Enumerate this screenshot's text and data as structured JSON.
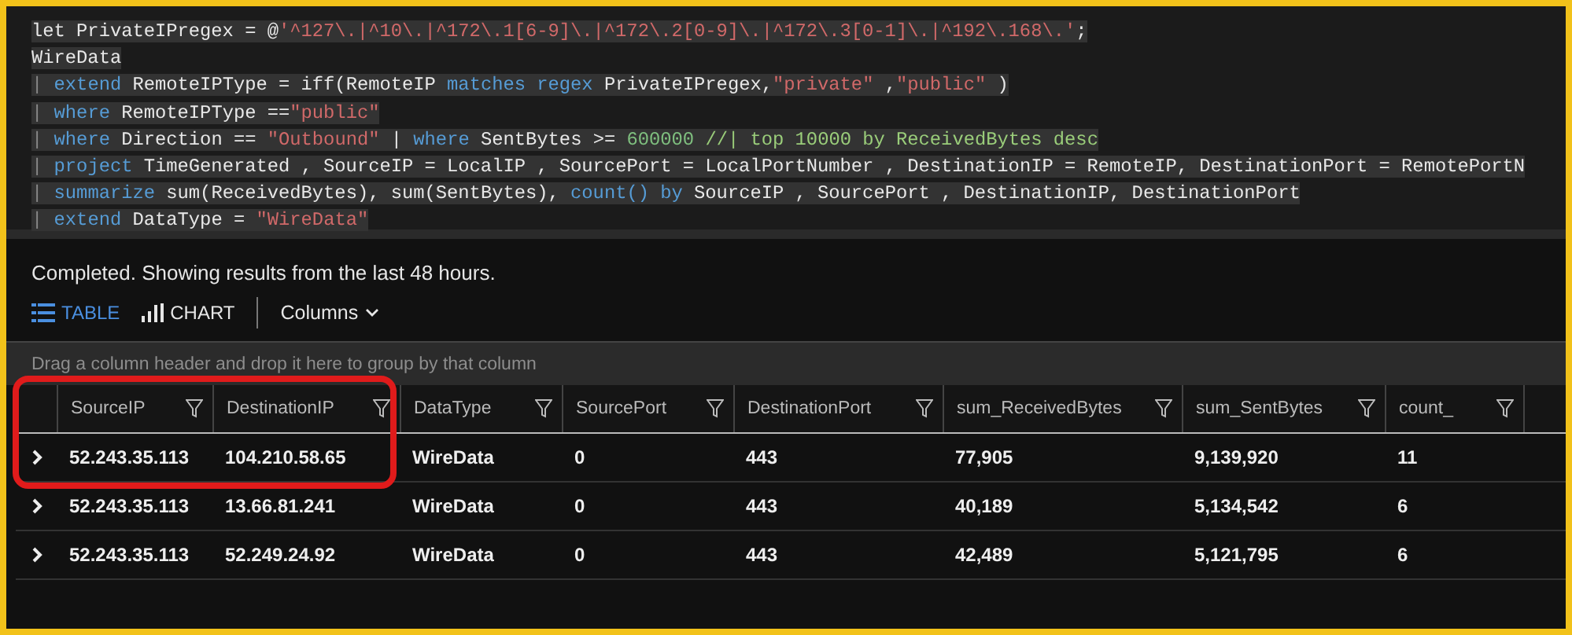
{
  "editor": {
    "lines": [
      [
        {
          "kind": "plain",
          "text": "let PrivateIPregex = @"
        },
        {
          "kind": "string",
          "text": "'^127\\.|^10\\.|^172\\.1[6-9]\\.|^172\\.2[0-9]\\.|^172\\.3[0-1]\\.|^192\\.168\\.'"
        },
        {
          "kind": "plain",
          "text": ";"
        }
      ],
      [
        {
          "kind": "plain",
          "text": "WireData"
        }
      ],
      [
        {
          "kind": "pipe",
          "text": "| "
        },
        {
          "kind": "keyword",
          "text": "extend"
        },
        {
          "kind": "plain",
          "text": " RemoteIPType = iff(RemoteIP "
        },
        {
          "kind": "keyword",
          "text": "matches regex"
        },
        {
          "kind": "plain",
          "text": " PrivateIPregex,"
        },
        {
          "kind": "string",
          "text": "\"private\""
        },
        {
          "kind": "plain",
          "text": " ,"
        },
        {
          "kind": "string",
          "text": "\"public\""
        },
        {
          "kind": "plain",
          "text": " )"
        }
      ],
      [
        {
          "kind": "pipe",
          "text": "| "
        },
        {
          "kind": "keyword",
          "text": "where"
        },
        {
          "kind": "plain",
          "text": " RemoteIPType =="
        },
        {
          "kind": "string",
          "text": "\"public\""
        }
      ],
      [
        {
          "kind": "pipe",
          "text": "| "
        },
        {
          "kind": "keyword",
          "text": "where"
        },
        {
          "kind": "plain",
          "text": " Direction == "
        },
        {
          "kind": "string",
          "text": "\"Outbound\""
        },
        {
          "kind": "plain",
          "text": " | "
        },
        {
          "kind": "keyword",
          "text": "where"
        },
        {
          "kind": "plain",
          "text": " SentBytes >= "
        },
        {
          "kind": "number",
          "text": "600000"
        },
        {
          "kind": "comment",
          "text": " //| top 10000 by ReceivedBytes desc"
        }
      ],
      [
        {
          "kind": "pipe",
          "text": "| "
        },
        {
          "kind": "keyword",
          "text": "project"
        },
        {
          "kind": "plain",
          "text": " TimeGenerated , SourceIP = LocalIP , SourcePort = LocalPortNumber , DestinationIP = RemoteIP, DestinationPort = RemotePortN"
        }
      ],
      [
        {
          "kind": "pipe",
          "text": "| "
        },
        {
          "kind": "keyword",
          "text": "summarize"
        },
        {
          "kind": "plain",
          "text": " sum(ReceivedBytes), sum(SentBytes), "
        },
        {
          "kind": "keyword",
          "text": "count() by"
        },
        {
          "kind": "plain",
          "text": " SourceIP , SourcePort , DestinationIP, DestinationPort"
        }
      ],
      [
        {
          "kind": "pipe",
          "text": "| "
        },
        {
          "kind": "keyword",
          "text": "extend"
        },
        {
          "kind": "plain",
          "text": " DataType = "
        },
        {
          "kind": "string",
          "text": "\"WireData\""
        }
      ]
    ]
  },
  "status": "Completed. Showing results from the last 48 hours.",
  "view_tabs": [
    {
      "label": "TABLE",
      "kind": "table",
      "selected": true
    },
    {
      "label": "CHART",
      "kind": "chart",
      "selected": false
    }
  ],
  "columns_button": "Columns",
  "group_hint": "Drag a column header and drop it here to group by that column",
  "table": {
    "columns": [
      "SourceIP",
      "DestinationIP",
      "DataType",
      "SourcePort",
      "DestinationPort",
      "sum_ReceivedBytes",
      "sum_SentBytes",
      "count_"
    ],
    "rows": [
      [
        "52.243.35.113",
        "104.210.58.65",
        "WireData",
        "0",
        "443",
        "77,905",
        "9,139,920",
        "11"
      ],
      [
        "52.243.35.113",
        "13.66.81.241",
        "WireData",
        "0",
        "443",
        "40,189",
        "5,134,542",
        "6"
      ],
      [
        "52.243.35.113",
        "52.249.24.92",
        "WireData",
        "0",
        "443",
        "42,489",
        "5,121,795",
        "6"
      ]
    ]
  }
}
